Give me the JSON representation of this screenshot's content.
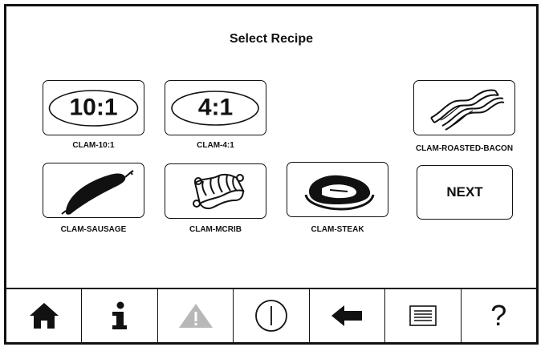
{
  "header": {
    "title": "Select Recipe"
  },
  "recipes": [
    {
      "caption": "CLAM-10:1",
      "ratio": "10:1",
      "icon": "ratio-10-1-icon"
    },
    {
      "caption": "CLAM-4:1",
      "ratio": "4:1",
      "icon": "ratio-4-1-icon"
    },
    {
      "caption": "CLAM-ROASTED-BACON",
      "icon": "bacon-icon"
    },
    {
      "caption": "CLAM-SAUSAGE",
      "icon": "sausage-icon"
    },
    {
      "caption": "CLAM-MCRIB",
      "icon": "mcrib-icon"
    },
    {
      "caption": "CLAM-STEAK",
      "icon": "steak-icon"
    }
  ],
  "next_button": {
    "label": "NEXT"
  },
  "toolbar": {
    "items": [
      {
        "icon": "home-icon"
      },
      {
        "icon": "info-icon"
      },
      {
        "icon": "warning-icon",
        "state": "disabled"
      },
      {
        "icon": "power-icon"
      },
      {
        "icon": "back-arrow-icon"
      },
      {
        "icon": "menu-list-icon"
      },
      {
        "icon": "help-icon",
        "glyph": "?"
      }
    ]
  },
  "colors": {
    "border": "#111111",
    "disabled": "#b8b8b8",
    "background": "#ffffff"
  }
}
